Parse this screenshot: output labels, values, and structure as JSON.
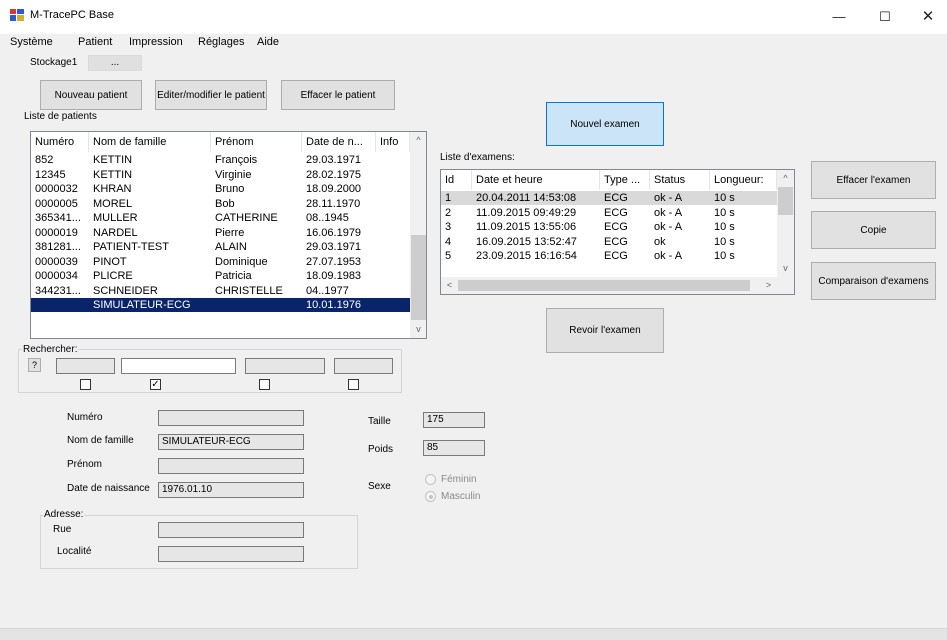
{
  "window": {
    "title": "M-TracePC Base",
    "minimize_glyph": "—",
    "maximize_glyph": "☐",
    "close_glyph": "✕"
  },
  "menu": [
    "Système",
    "Patient",
    "Impression",
    "Réglages",
    "Aide"
  ],
  "tabs": [
    "Stockage1",
    "..."
  ],
  "buttons": {
    "new_patient": "Nouveau patient",
    "edit_patient": "Editer/modifier le patient",
    "delete_patient": "Effacer le patient",
    "new_exam": "Nouvel examen",
    "delete_exam": "Effacer l'examen",
    "copy": "Copie",
    "compare_exams": "Comparaison d'examens",
    "review_exam": "Revoir l'examen",
    "search_help": "?"
  },
  "patients": {
    "label": "Liste de patients",
    "columns": [
      "Numéro",
      "Nom de famille",
      "Prénom",
      "Date de n...",
      "Info"
    ],
    "rows": [
      [
        "852",
        "KETTIN",
        "François",
        "29.03.1971",
        ""
      ],
      [
        "12345",
        "KETTIN",
        "Virginie",
        "28.02.1975",
        ""
      ],
      [
        "0000032",
        "KHRAN",
        "Bruno",
        "18.09.2000",
        ""
      ],
      [
        "0000005",
        "MOREL",
        "Bob",
        "28.11.1970",
        ""
      ],
      [
        "365341...",
        "MULLER",
        "CATHERINE",
        "08..1945",
        ""
      ],
      [
        "0000019",
        "NARDEL",
        "Pierre",
        "16.06.1979",
        ""
      ],
      [
        "381281...",
        "PATIENT-TEST",
        "ALAIN",
        "29.03.1971",
        ""
      ],
      [
        "0000039",
        "PINOT",
        "Dominique",
        "27.07.1953",
        ""
      ],
      [
        "0000034",
        "PLICRE",
        "Patricia",
        "18.09.1983",
        ""
      ],
      [
        "344231...",
        "SCHNEIDER",
        "CHRISTELLE",
        "04..1977",
        ""
      ],
      [
        "",
        "SIMULATEUR-ECG",
        "",
        "10.01.1976",
        ""
      ]
    ],
    "selected_index": 10
  },
  "search": {
    "label": "Rechercher:",
    "checkboxes": [
      false,
      true,
      false,
      false
    ],
    "check_glyph": "✓"
  },
  "exams": {
    "label": "Liste d'examens:",
    "columns": [
      "Id",
      "Date et heure",
      "Type ...",
      "Status",
      "Longueur:"
    ],
    "rows": [
      [
        "1",
        "20.04.2011  14:53:08",
        "ECG",
        "ok - A",
        "10 s"
      ],
      [
        "2",
        "11.09.2015  09:49:29",
        "ECG",
        "ok - A",
        "10 s"
      ],
      [
        "3",
        "11.09.2015  13:55:06",
        "ECG",
        "ok - A",
        "10 s"
      ],
      [
        "4",
        "16.09.2015  13:52:47",
        "ECG",
        "ok",
        "10 s"
      ],
      [
        "5",
        "23.09.2015  16:16:54",
        "ECG",
        "ok - A",
        "10 s"
      ]
    ],
    "highlighted_index": 0
  },
  "scroll_glyphs": {
    "up": "^",
    "down": "v",
    "left": "<",
    "right": ">"
  },
  "details": {
    "numero_label": "Numéro",
    "numero_value": "",
    "nom_label": "Nom de famille",
    "nom_value": "SIMULATEUR-ECG",
    "prenom_label": "Prénom",
    "prenom_value": "",
    "naissance_label": "Date de naissance",
    "naissance_value": "1976.01.10",
    "adresse_label": "Adresse:",
    "rue_label": "Rue",
    "rue_value": "",
    "localite_label": "Localité",
    "localite_value": "",
    "taille_label": "Taille",
    "taille_value": "175",
    "poids_label": "Poids",
    "poids_value": "85",
    "sexe_label": "Sexe",
    "sexe_options": [
      "Féminin",
      "Masculin"
    ],
    "sexe_selected": "Masculin"
  },
  "colors": {
    "selection": "#0a246a",
    "button_blue": "#cce4f7",
    "button_border_blue": "#0078d7"
  }
}
